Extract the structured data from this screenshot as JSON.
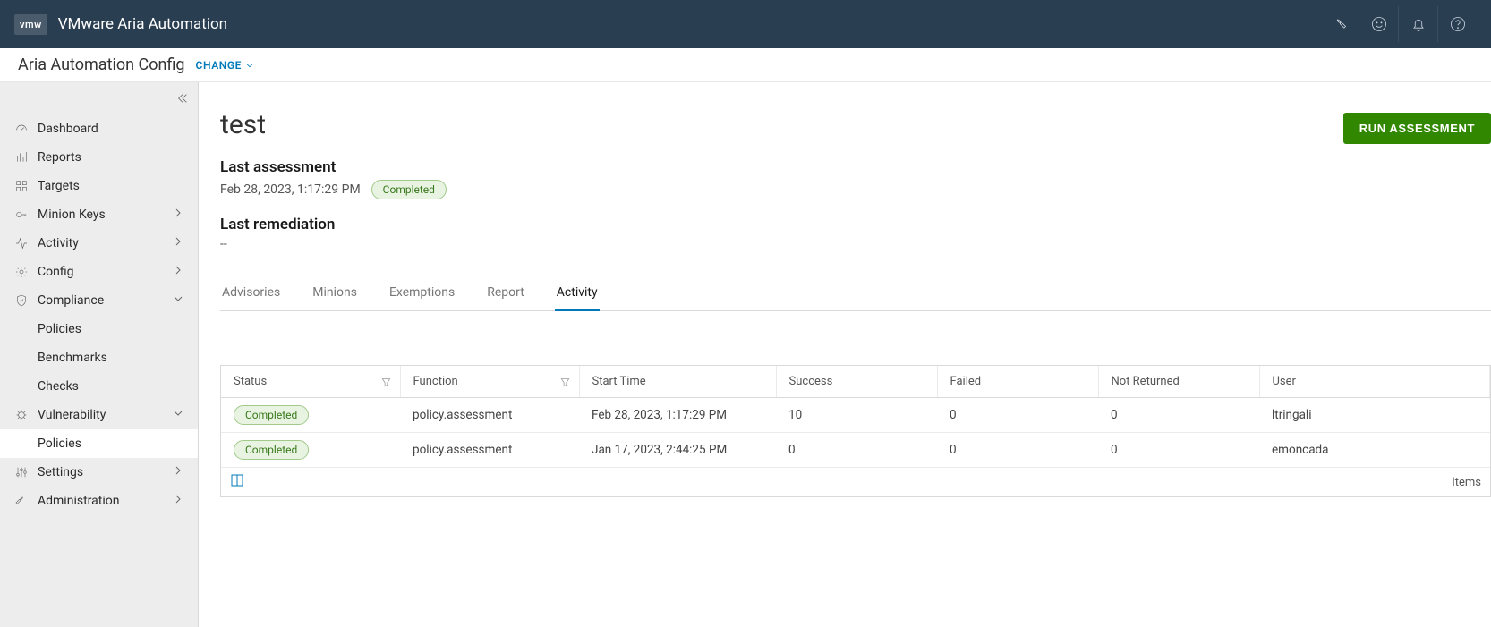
{
  "header": {
    "logo": "vmw",
    "product": "VMware Aria Automation"
  },
  "subheader": {
    "title": "Aria Automation Config",
    "change_label": "CHANGE"
  },
  "sidebar": {
    "dashboard": "Dashboard",
    "reports": "Reports",
    "targets": "Targets",
    "minion_keys": "Minion Keys",
    "activity": "Activity",
    "config": "Config",
    "compliance": "Compliance",
    "compliance_children": {
      "policies": "Policies",
      "benchmarks": "Benchmarks",
      "checks": "Checks"
    },
    "vulnerability": "Vulnerability",
    "vulnerability_children": {
      "policies": "Policies"
    },
    "settings": "Settings",
    "administration": "Administration"
  },
  "page": {
    "title": "test",
    "run_button": "RUN ASSESSMENT",
    "last_assessment_label": "Last assessment",
    "last_assessment_time": "Feb 28, 2023, 1:17:29 PM",
    "last_assessment_status": "Completed",
    "last_remediation_label": "Last remediation",
    "last_remediation_value": "--"
  },
  "tabs": {
    "advisories": "Advisories",
    "minions": "Minions",
    "exemptions": "Exemptions",
    "report": "Report",
    "activity": "Activity"
  },
  "table": {
    "headers": {
      "status": "Status",
      "function": "Function",
      "start_time": "Start Time",
      "success": "Success",
      "failed": "Failed",
      "not_returned": "Not Returned",
      "user": "User"
    },
    "rows": [
      {
        "status": "Completed",
        "function": "policy.assessment",
        "start_time": "Feb 28, 2023, 1:17:29 PM",
        "success": "10",
        "failed": "0",
        "not_returned": "0",
        "user": "ltringali"
      },
      {
        "status": "Completed",
        "function": "policy.assessment",
        "start_time": "Jan 17, 2023, 2:44:25 PM",
        "success": "0",
        "failed": "0",
        "not_returned": "0",
        "user": "emoncada"
      }
    ],
    "footer_items": "Items"
  }
}
